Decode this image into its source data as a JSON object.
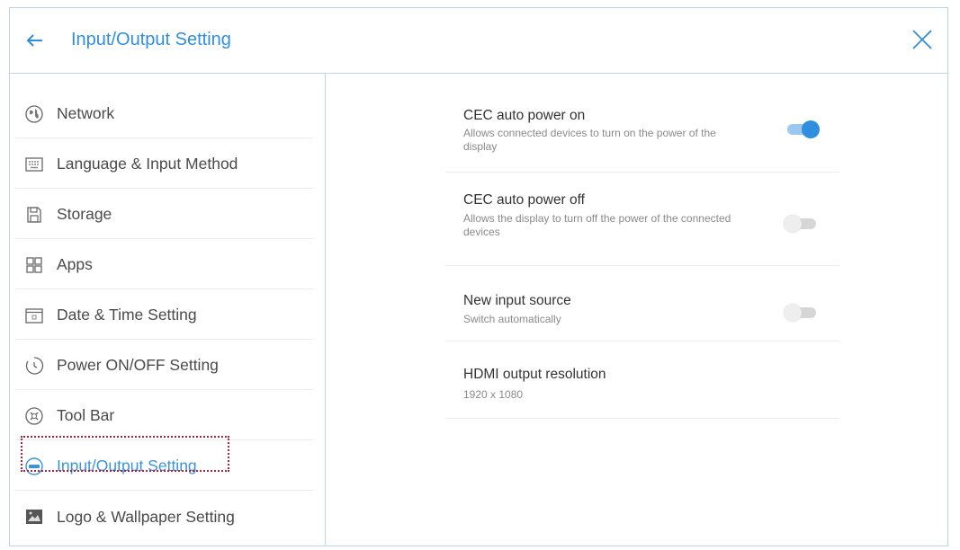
{
  "header": {
    "title": "Input/Output Setting",
    "back_icon": "arrow-left-icon",
    "close_icon": "close-icon"
  },
  "colors": {
    "accent": "#2f8fde",
    "active_outline": "#b0233a"
  },
  "sidebar": {
    "items": [
      {
        "label": "Network",
        "icon": "globe-icon"
      },
      {
        "label": "Language & Input Method",
        "icon": "keyboard-icon"
      },
      {
        "label": "Storage",
        "icon": "storage-icon"
      },
      {
        "label": "Apps",
        "icon": "apps-grid-icon"
      },
      {
        "label": "Date & Time Setting",
        "icon": "calendar-icon"
      },
      {
        "label": "Power ON/OFF Setting",
        "icon": "power-timer-icon"
      },
      {
        "label": "Tool Bar",
        "icon": "toolbar-icon"
      },
      {
        "label": "Input/Output Setting",
        "icon": "input-output-icon",
        "selected": true
      },
      {
        "label": "Logo & Wallpaper Setting",
        "icon": "wallpaper-icon"
      }
    ]
  },
  "settings": [
    {
      "title": "CEC auto power on",
      "desc": "Allows connected devices to turn on the power of the display",
      "toggle": true
    },
    {
      "title": "CEC auto power off",
      "desc": "Allows the display to turn off the power of the connected devices",
      "toggle": false
    },
    {
      "title": "New input source",
      "desc": "Switch automatically",
      "toggle": false
    },
    {
      "title": "HDMI output resolution",
      "desc": "1920 x 1080"
    }
  ]
}
